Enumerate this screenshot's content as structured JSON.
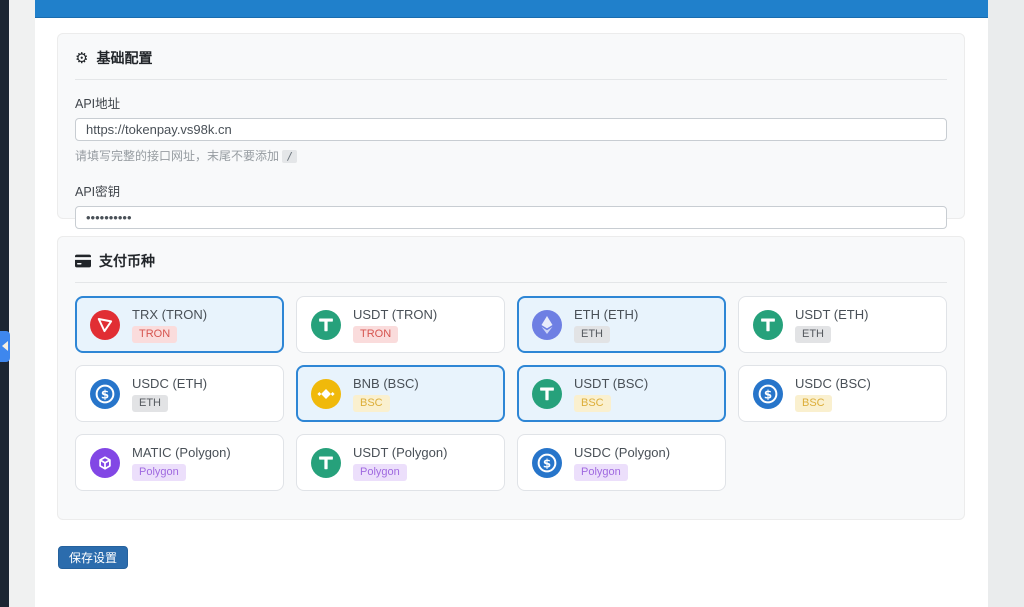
{
  "basic_config": {
    "icon": "⚙",
    "title": "基础配置",
    "api_url": {
      "label": "API地址",
      "value": "https://tokenpay.vs98k.cn",
      "help_text": "请填写完整的接口网址，末尾不要添加",
      "help_code": "/"
    },
    "api_key": {
      "label": "API密钥",
      "value": "••••••••••"
    }
  },
  "payment": {
    "title": "支付币种",
    "tiles": [
      {
        "name": "TRX (TRON)",
        "network": "TRON",
        "coin": "trx",
        "selected": true
      },
      {
        "name": "USDT (TRON)",
        "network": "TRON",
        "coin": "usdt",
        "selected": false
      },
      {
        "name": "ETH (ETH)",
        "network": "ETH",
        "coin": "eth",
        "selected": true
      },
      {
        "name": "USDT (ETH)",
        "network": "ETH",
        "coin": "usdt",
        "selected": false
      },
      {
        "name": "USDC (ETH)",
        "network": "ETH",
        "coin": "usdc",
        "selected": false
      },
      {
        "name": "BNB (BSC)",
        "network": "BSC",
        "coin": "bnb",
        "selected": true
      },
      {
        "name": "USDT (BSC)",
        "network": "BSC",
        "coin": "usdt",
        "selected": true
      },
      {
        "name": "USDC (BSC)",
        "network": "BSC",
        "coin": "usdc",
        "selected": false
      },
      {
        "name": "MATIC (Polygon)",
        "network": "Polygon",
        "coin": "matic",
        "selected": false
      },
      {
        "name": "USDT (Polygon)",
        "network": "Polygon",
        "coin": "usdt",
        "selected": false
      },
      {
        "name": "USDC (Polygon)",
        "network": "Polygon",
        "coin": "usdc",
        "selected": false
      }
    ]
  },
  "actions": {
    "save_label": "保存设置"
  },
  "colors": {
    "topbar": "#2080cb",
    "selected_tile_border": "#2e86d5",
    "selected_tile_bg": "#e8f3fc",
    "save_button": "#2b6cad",
    "sidebar_toggle": "#3e87ee",
    "coin_trx": "#e12e34",
    "coin_usdt": "#26a17b",
    "coin_eth": "#6e7fe3",
    "coin_usdc": "#2775ca",
    "coin_bnb": "#f0b90b",
    "coin_matic": "#8247e5",
    "badge_tron": "#d65550",
    "badge_eth": "#55595e",
    "badge_bsc": "#dcae3a",
    "badge_polygon": "#a06ae0"
  }
}
